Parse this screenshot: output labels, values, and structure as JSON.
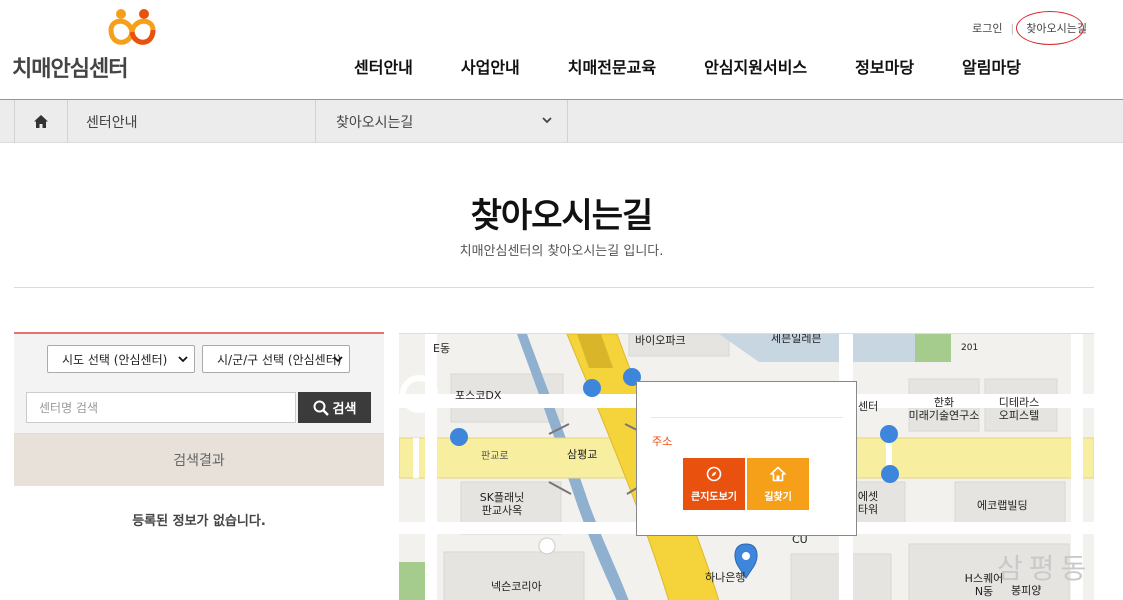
{
  "brand": {
    "name": "치매안심센터"
  },
  "util": {
    "login": "로그인",
    "directions": "찾아오시는길"
  },
  "nav": [
    "센터안내",
    "사업안내",
    "치매전문교육",
    "안심지원서비스",
    "정보마당",
    "알림마당"
  ],
  "breadcrumb": {
    "level1": "센터안내",
    "level2": "찾아오시는길"
  },
  "page": {
    "title": "찾아오시는길",
    "subtitle": "치매안심센터의 찾아오시는길 입니다."
  },
  "search": {
    "sido_selected": "시도 선택 (안심센터)",
    "sigungu_selected": "시/군/구 선택 (안심센터)",
    "placeholder": "센터명 검색",
    "button": "검색",
    "result_header": "검색결과",
    "empty_message": "등록된 정보가 없습니다."
  },
  "map": {
    "labels": {
      "bio_park": "바이오파크",
      "se_building": "세븐일레븐",
      "e_dong": "E동",
      "posco": "포스코DX",
      "hanwha_1": "한화",
      "hanwha_2": "미래기술연구소",
      "ditera_1": "디테라스",
      "ditera_2": "오피스텔",
      "center": "센터",
      "pangyo_ro": "판교로",
      "sampyeong": "삼평교",
      "sk_1": "SK플래닛",
      "sk_2": "판교사옥",
      "yeset_1": "에셋",
      "yeset_2": "타워",
      "ecolab": "에코랩빌딩",
      "cu": "CU",
      "nexon": "넥슨코리아",
      "hana": "하나은행",
      "hsquare_1": "H스퀘어",
      "hsquare_2": "N동",
      "bongpiyang": "봉피양",
      "sampyeong_dong": "삼평동",
      "bldg_201": "201"
    },
    "popup": {
      "address_label": "주소",
      "bigmap_button": "큰지도보기",
      "route_button": "길찾기"
    }
  },
  "colors": {
    "accent_red": "#e37472",
    "brand_orange": "#e9510e",
    "brand_yellow": "#f6a01a",
    "search_button": "#3b3b3b",
    "map_road": "#f7eea0",
    "map_highway": "#f5d33b",
    "map_water": "#8fb0cf",
    "marker": "#3d86dc"
  }
}
